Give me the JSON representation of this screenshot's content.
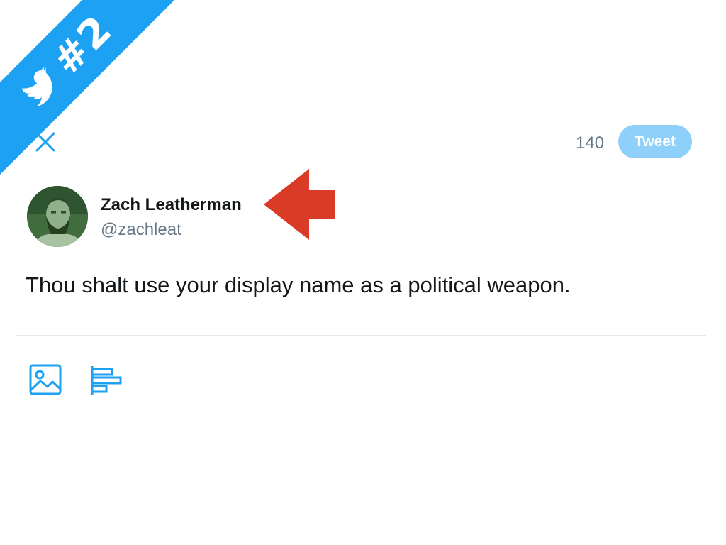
{
  "ribbon": {
    "label": "#2",
    "icon": "twitter-bird-icon",
    "color": "#1da1f2"
  },
  "compose": {
    "close_icon": "close-icon",
    "char_count": "140",
    "tweet_label": "Tweet",
    "tweet_button_color": "#8ed0f9"
  },
  "user": {
    "display_name": "Zach Leatherman",
    "handle": "@zachleat",
    "avatar_icon": "avatar"
  },
  "annotation": {
    "icon": "arrow-left-icon",
    "color": "#d93b26"
  },
  "tweet": {
    "text": "Thou shalt use your display name as a political weapon."
  },
  "toolbar": {
    "media_icon": "image-icon",
    "poll_icon": "poll-icon",
    "accent": "#1da1f2"
  }
}
